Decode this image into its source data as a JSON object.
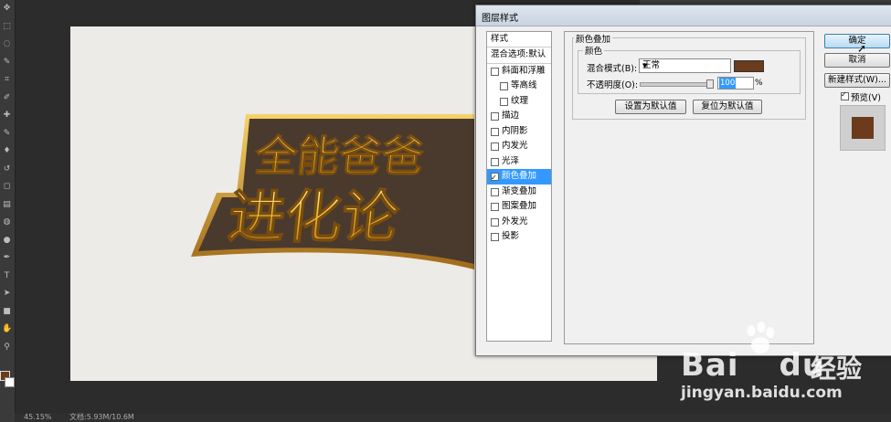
{
  "toolbar": {
    "tools": [
      "move-icon",
      "marquee-icon",
      "lasso-icon",
      "quick-select-icon",
      "crop-icon",
      "eyedropper-icon",
      "healing-icon",
      "brush-icon",
      "stamp-icon",
      "history-brush-icon",
      "eraser-icon",
      "gradient-icon",
      "blur-icon",
      "dodge-icon",
      "pen-icon",
      "type-icon",
      "path-select-icon",
      "shape-icon",
      "hand-icon",
      "zoom-icon"
    ],
    "foreground_color": "#6b3b1c",
    "background_color": "#ffffff"
  },
  "canvas": {
    "logo_line1": "全能爸爸",
    "logo_line2": "进化论"
  },
  "statusbar": {
    "zoom": "45.15%",
    "doc": "文档:5.93M/10.6M"
  },
  "dialog": {
    "title": "图层样式",
    "styles_header": "样式",
    "blend_options": "混合选项:默认",
    "style_items": [
      {
        "label": "斜面和浮雕",
        "checked": false,
        "indent": false,
        "selected": false
      },
      {
        "label": "等高线",
        "checked": false,
        "indent": true,
        "selected": false
      },
      {
        "label": "纹理",
        "checked": false,
        "indent": true,
        "selected": false
      },
      {
        "label": "描边",
        "checked": false,
        "indent": false,
        "selected": false
      },
      {
        "label": "内阴影",
        "checked": false,
        "indent": false,
        "selected": false
      },
      {
        "label": "内发光",
        "checked": false,
        "indent": false,
        "selected": false
      },
      {
        "label": "光泽",
        "checked": false,
        "indent": false,
        "selected": false
      },
      {
        "label": "颜色叠加",
        "checked": true,
        "indent": false,
        "selected": true
      },
      {
        "label": "渐变叠加",
        "checked": false,
        "indent": false,
        "selected": false
      },
      {
        "label": "图案叠加",
        "checked": false,
        "indent": false,
        "selected": false
      },
      {
        "label": "外发光",
        "checked": false,
        "indent": false,
        "selected": false
      },
      {
        "label": "投影",
        "checked": false,
        "indent": false,
        "selected": false
      }
    ],
    "section_title": "颜色叠加",
    "group_title": "颜色",
    "blend_mode_label": "混合模式(B):",
    "blend_mode_value": "正常",
    "overlay_color": "#6b3b1c",
    "opacity_label": "不透明度(O):",
    "opacity_value": "100",
    "opacity_unit": "%",
    "opacity_level": 100,
    "make_default": "设置为默认值",
    "reset_default": "复位为默认值",
    "ok": "确定",
    "cancel": "取消",
    "new_style": "新建样式(W)...",
    "preview_label": "预览(V)",
    "preview_checked": true
  },
  "watermark": {
    "brand_latin": "Bai",
    "brand_du": "du",
    "brand_cn": "经验",
    "url": "jingyan.baidu.com"
  }
}
